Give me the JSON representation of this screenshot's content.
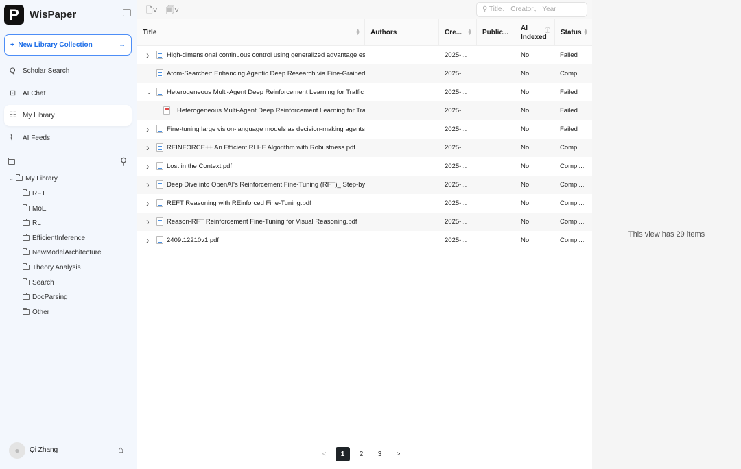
{
  "app": {
    "name": "WisPaper",
    "logo": "P"
  },
  "sidebar": {
    "new_collection": "New Library Collection",
    "nav": [
      {
        "label": "Scholar Search",
        "icon": "search-icon"
      },
      {
        "label": "AI Chat",
        "icon": "ai-chat-icon"
      },
      {
        "label": "My Library",
        "icon": "library-icon",
        "active": true
      },
      {
        "label": "AI Feeds",
        "icon": "rss-icon"
      }
    ],
    "tree_root": "My Library",
    "folders": [
      "RFT",
      "MoE",
      "RL",
      "EfficientInference",
      "NewModelArchitecture",
      "Theory Analysis",
      "Search",
      "DocParsing",
      "Other"
    ],
    "user": "Qi Zhang"
  },
  "toolbar": {
    "search_placeholder": "Title、 Creator、 Year"
  },
  "table": {
    "columns": [
      "Title",
      "Authors",
      "Cre...",
      "Public...",
      "AI Indexed",
      "Status"
    ],
    "rows": [
      {
        "title": "High-dimensional continuous control using generalized advantage estimati",
        "created": "2025-...",
        "ai": "No",
        "status": "Failed",
        "exp": ">"
      },
      {
        "title": "Atom-Searcher: Enhancing Agentic Deep Research via Fine-Grained Atomi",
        "created": "2025-...",
        "ai": "No",
        "status": "Compl...",
        "exp": ""
      },
      {
        "title": "Heterogeneous Multi-Agent Deep Reinforcement Learning for Traffic Light:",
        "created": "2025-...",
        "ai": "No",
        "status": "Failed",
        "exp": "v"
      },
      {
        "title": "Heterogeneous Multi-Agent Deep Reinforcement Learning for Traffic L",
        "created": "2025-...",
        "ai": "No",
        "status": "Failed",
        "exp": "",
        "child": true
      },
      {
        "title": "Fine-tuning large vision-language models as decision-making agents via r",
        "created": "2025-...",
        "ai": "No",
        "status": "Failed",
        "exp": ">"
      },
      {
        "title": "REINFORCE++ An Efficient RLHF Algorithm with Robustness.pdf",
        "created": "2025-...",
        "ai": "No",
        "status": "Compl...",
        "exp": ">"
      },
      {
        "title": "Lost in the Context.pdf",
        "created": "2025-...",
        "ai": "No",
        "status": "Compl...",
        "exp": ">"
      },
      {
        "title": "Deep Dive into OpenAI's Reinforcement Fine-Tuning (RFT)_ Step-by-Step",
        "created": "2025-...",
        "ai": "No",
        "status": "Compl...",
        "exp": ">"
      },
      {
        "title": "REFT Reasoning with REinforced Fine-Tuning.pdf",
        "created": "2025-...",
        "ai": "No",
        "status": "Compl...",
        "exp": ">"
      },
      {
        "title": "Reason-RFT Reinforcement Fine-Tuning for Visual Reasoning.pdf",
        "created": "2025-...",
        "ai": "No",
        "status": "Compl...",
        "exp": ">"
      },
      {
        "title": "2409.12210v1.pdf",
        "created": "2025-...",
        "ai": "No",
        "status": "Compl...",
        "exp": ">"
      }
    ]
  },
  "pagination": {
    "pages": [
      "1",
      "2",
      "3"
    ],
    "current": "1",
    "prev": "<",
    "next": ">"
  },
  "right_panel": {
    "message": "This view has 29 items"
  }
}
